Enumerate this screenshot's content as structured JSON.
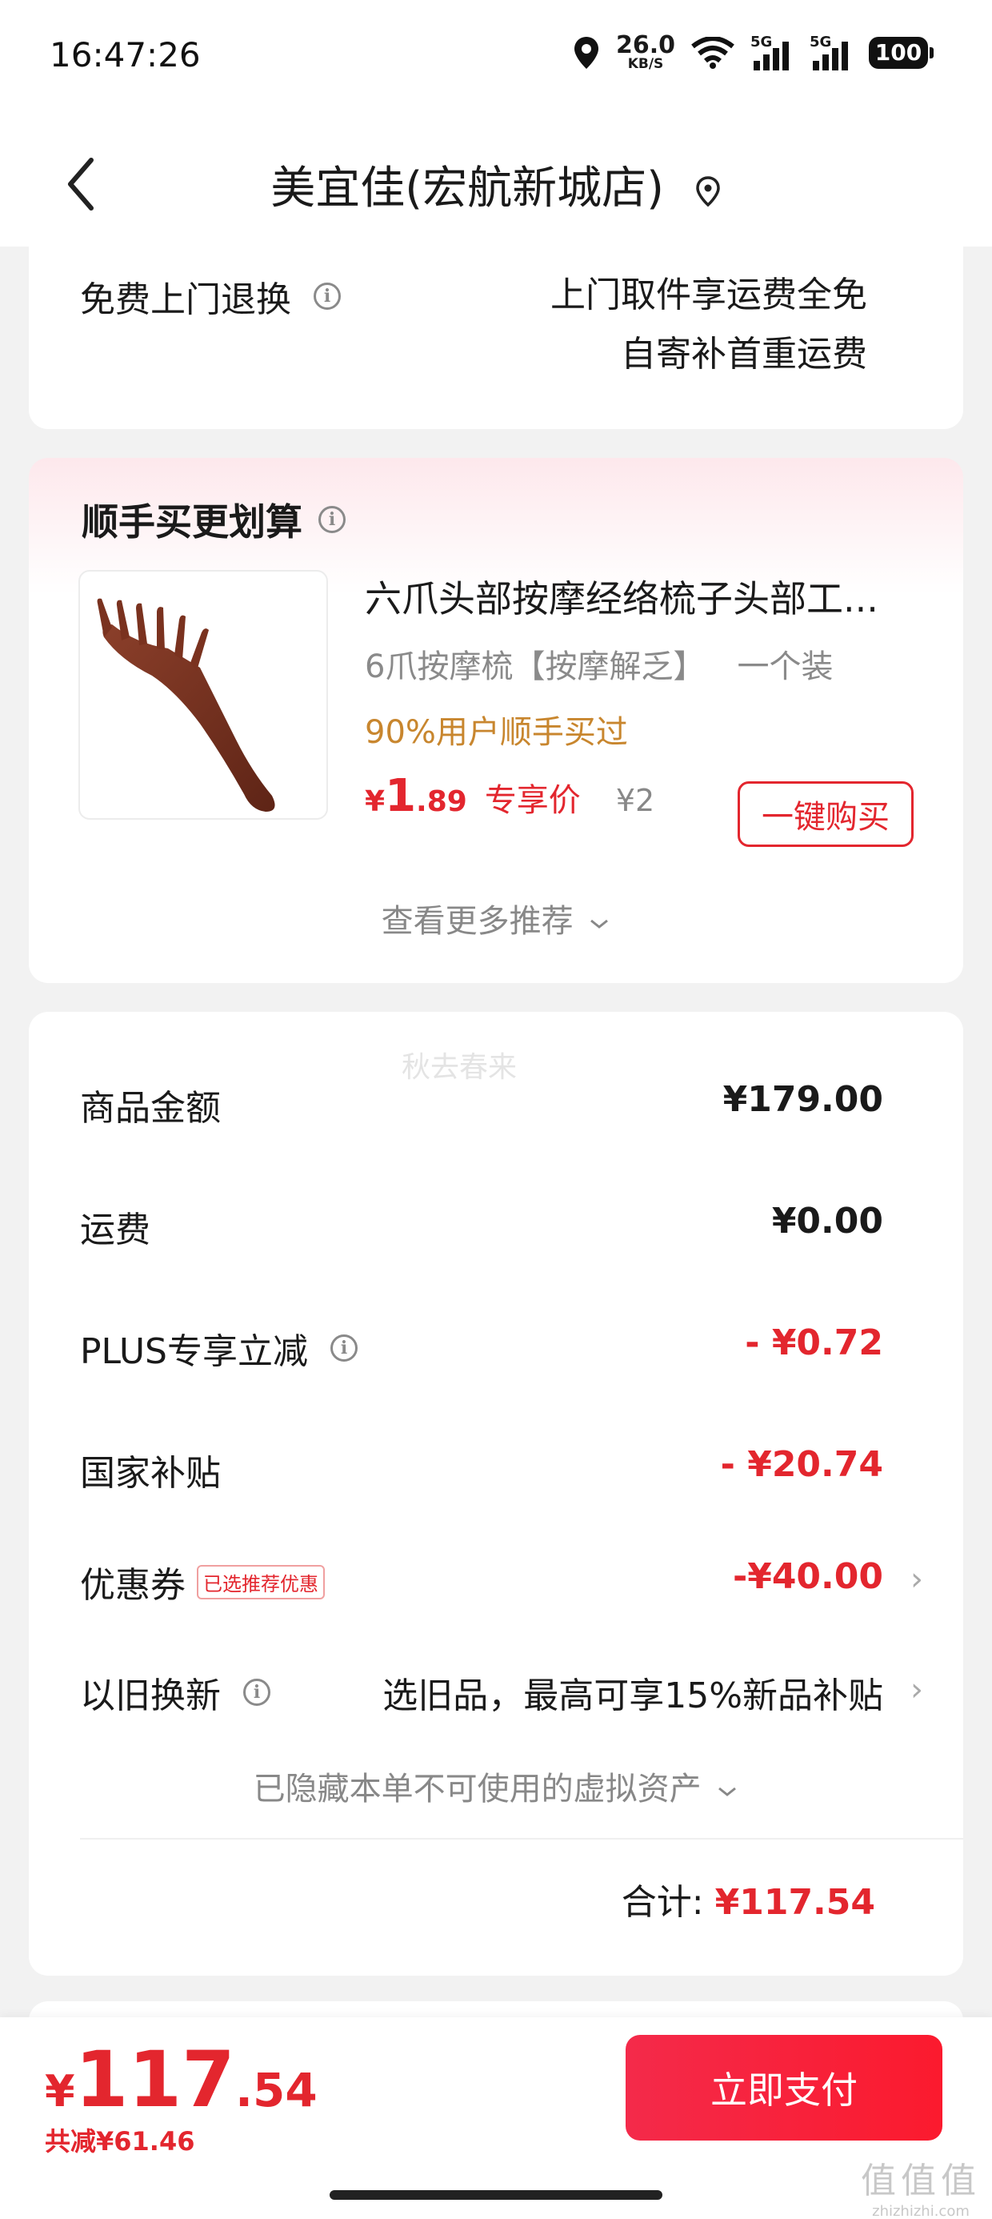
{
  "status_bar": {
    "time": "16:47:26",
    "net_speed": "26.0",
    "net_unit": "KB/S",
    "sim1": "5G",
    "sim2": "5G",
    "battery": "100"
  },
  "nav": {
    "title": "美宜佳(宏航新城店)",
    "back_icon": "chevron-left-icon",
    "location_icon": "location-pin-icon"
  },
  "return_card": {
    "label": "免费上门退换",
    "line1": "上门取件享运费全免",
    "line2": "自寄补首重运费"
  },
  "recommend": {
    "title": "顺手买更划算",
    "product": {
      "name": "六爪头部按摩经络梳子头部工...",
      "spec": "6爪按摩梳【按摩解乏】",
      "quantity": "一个装",
      "social_proof": "90%用户顺手买过",
      "price_symbol": "¥",
      "price_int": "1",
      "price_dec": ".89",
      "price_tag": "专享价",
      "original_price": "¥2",
      "buy_button": "一键购买"
    },
    "more_label": "查看更多推荐"
  },
  "summary": {
    "watermark": "秋去春来",
    "rows": [
      {
        "label": "商品金额",
        "value": "¥179.00"
      },
      {
        "label": "运费",
        "value": "¥0.00"
      },
      {
        "label": "PLUS专享立减",
        "value": "- ¥0.72"
      },
      {
        "label": "国家补贴",
        "value": "- ¥20.74"
      },
      {
        "label": "优惠券",
        "badge": "已选推荐优惠",
        "value": "-¥40.00"
      },
      {
        "label": "以旧换新",
        "value": "选旧品，最高可享15%新品补贴"
      }
    ],
    "hidden_assets": "已隐藏本单不可使用的虚拟资产",
    "total_label": "合计:",
    "total_value": "¥117.54"
  },
  "bottom": {
    "price_symbol": "¥",
    "price_int": "117",
    "price_dec": ".54",
    "saved": "共减¥61.46",
    "pay_button": "立即支付"
  },
  "watermark_site": {
    "line1": "值值值",
    "line2": "zhizhizhi.com"
  },
  "colors": {
    "accent_red": "#e3262e",
    "social_orange": "#c8862e",
    "pay_button": "#f42a4a"
  }
}
